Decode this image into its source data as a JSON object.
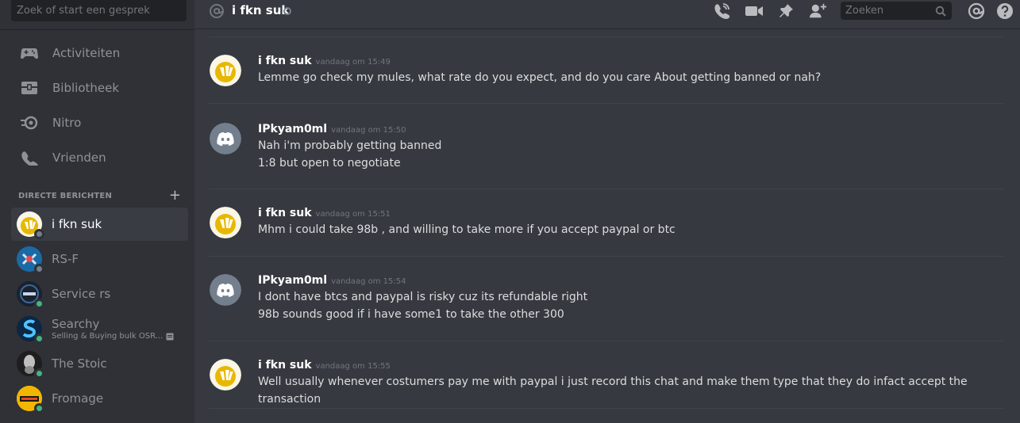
{
  "sidebar": {
    "search_placeholder": "Zoek of start een gesprek",
    "nav": [
      {
        "label": "Activiteiten",
        "icon": "gamepad-icon"
      },
      {
        "label": "Bibliotheek",
        "icon": "library-icon"
      },
      {
        "label": "Nitro",
        "icon": "nitro-icon"
      },
      {
        "label": "Vrienden",
        "icon": "friends-icon"
      }
    ],
    "dm_header": "DIRECTE BERICHTEN",
    "dms": [
      {
        "name": "i fkn suk",
        "status": "offline",
        "active": true
      },
      {
        "name": "RS-F",
        "status": "offline"
      },
      {
        "name": "Service rs",
        "status": "online"
      },
      {
        "name": "Searchy",
        "status": "online",
        "subtitle": "Selling & Buying bulk OSR..."
      },
      {
        "name": "The Stoic",
        "status": "online"
      },
      {
        "name": "Fromage",
        "status": "online"
      }
    ]
  },
  "topbar": {
    "channel_name": "i fkn suk",
    "search_placeholder": "Zoeken"
  },
  "messages": [
    {
      "author": "i fkn suk",
      "time": "vandaag om 15:49",
      "avatar": "yellow",
      "lines": [
        "Lemme go check my mules, what rate do you expect, and do you care About getting banned or nah?"
      ]
    },
    {
      "author": "IPkyam0ml",
      "time": "vandaag om 15:50",
      "avatar": "discord",
      "lines": [
        "Nah i'm probably getting banned",
        "1:8 but open to negotiate"
      ]
    },
    {
      "author": "i fkn suk",
      "time": "vandaag om 15:51",
      "avatar": "yellow",
      "lines": [
        "Mhm i could take 98b  , and willing to take more if you accept paypal or btc"
      ]
    },
    {
      "author": "IPkyam0ml",
      "time": "vandaag om 15:54",
      "avatar": "discord",
      "lines": [
        "I dont have btcs and paypal is risky cuz its refundable right",
        "98b sounds good if i have some1 to take the other 300"
      ]
    },
    {
      "author": "i fkn suk",
      "time": "vandaag om 15:55",
      "avatar": "yellow",
      "lines": [
        "Well usually whenever costumers pay me with paypal i just record this chat and make them type that they do infact accept the",
        "transaction"
      ]
    }
  ]
}
